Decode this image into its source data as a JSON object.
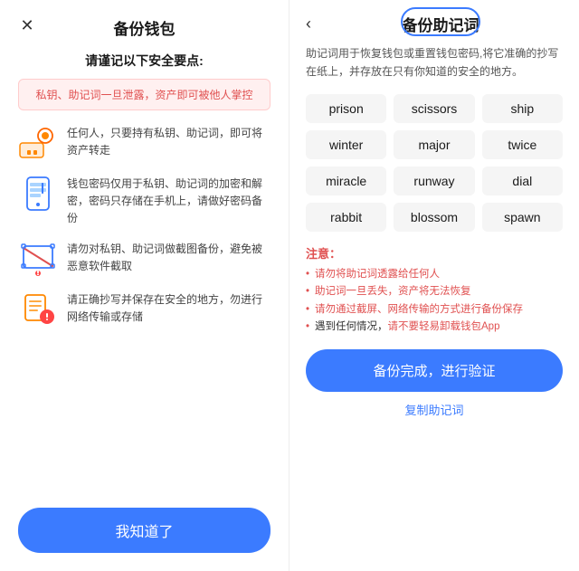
{
  "left": {
    "title": "备份钱包",
    "subtitle": "请谨记以下安全要点:",
    "warning": "私钥、助记词一旦泄露，资产即可被他人掌控",
    "tips": [
      {
        "id": "tip-key",
        "icon": "key-icon",
        "text": "任何人，只要持有私钥、助记词，即可将资产转走"
      },
      {
        "id": "tip-phone",
        "icon": "phone-icon",
        "text": "钱包密码仅用于私钥、助记词的加密和解密，密码只存储在手机上，请做好密码备份"
      },
      {
        "id": "tip-screenshot",
        "icon": "screenshot-icon",
        "text": "请勿对私钥、助记词做截图备份，避免被恶意软件截取"
      },
      {
        "id": "tip-note",
        "icon": "note-icon",
        "text": "请正确抄写并保存在安全的地方，勿进行网络传输或存储"
      }
    ],
    "button_label": "我知道了"
  },
  "right": {
    "back_label": "‹",
    "title": "备份助记词",
    "description": "助记词用于恢复钱包或重置钱包密码,将它准确的抄写在纸上，并存放在只有你知道的安全的地方。",
    "words": [
      "prison",
      "scissors",
      "ship",
      "winter",
      "major",
      "twice",
      "miracle",
      "runway",
      "dial",
      "rabbit",
      "blossom",
      "spawn"
    ],
    "notice_title": "注意：",
    "notices": [
      "请勿将助记词透露给任何人",
      "助记词一旦丢失，资产将无法恢复",
      "请勿通过截屏、网络传输的方式进行备份保存",
      "遇到任何情况，请不要轻易卸载钱包App"
    ],
    "notice_last_normal": "遇到任何情况，",
    "notice_last_red": "请不要轻易卸载钱包App",
    "confirm_button_label": "备份完成，进行验证",
    "copy_label": "复制助记词"
  }
}
